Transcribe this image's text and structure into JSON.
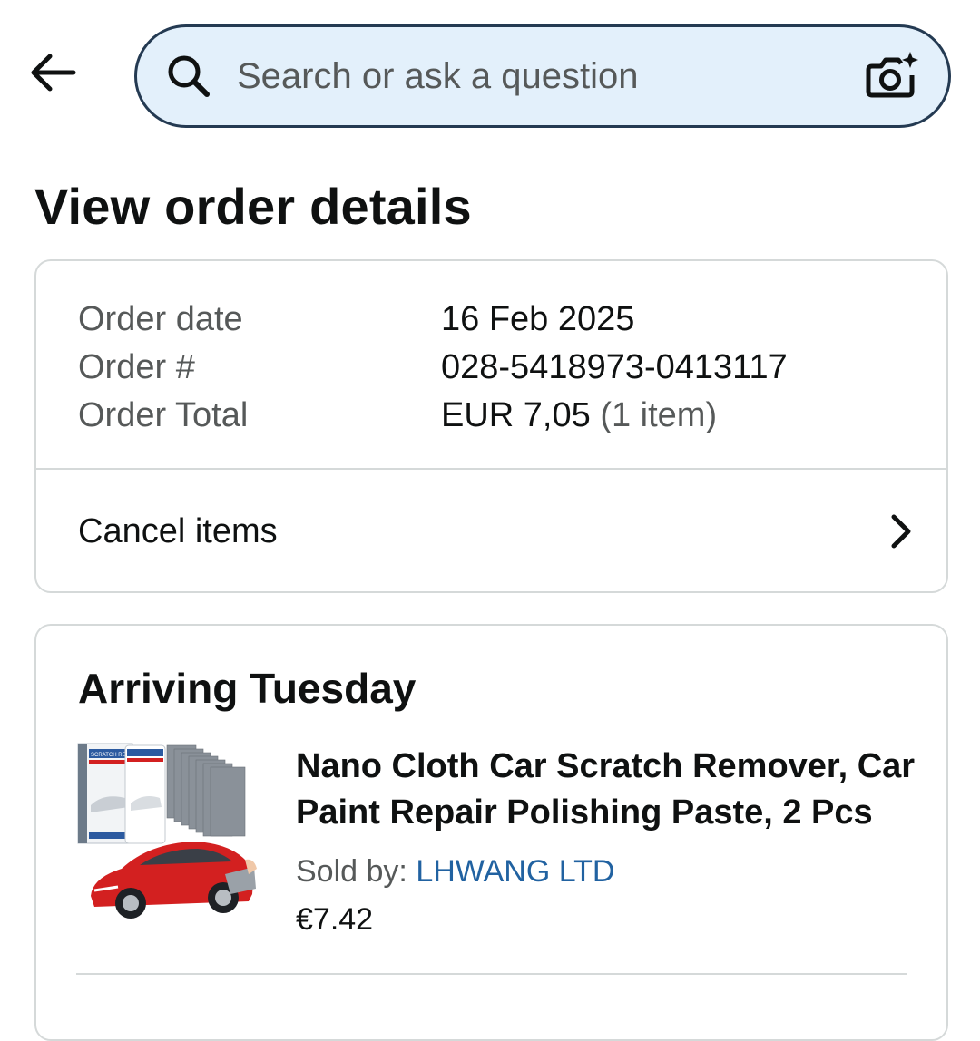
{
  "header": {
    "search_placeholder": "Search or ask a question"
  },
  "page": {
    "title": "View order details"
  },
  "summary": {
    "rows": [
      {
        "label": "Order date",
        "value": "16 Feb 2025"
      },
      {
        "label": "Order #",
        "value": "028-5418973-0413117"
      },
      {
        "label": "Order Total",
        "value": "EUR 7,05",
        "extra": "(1 item)"
      }
    ],
    "cancel_label": "Cancel items"
  },
  "shipment": {
    "title": "Arriving Tuesday",
    "product": {
      "name": "Nano Cloth Car Scratch Remover, Car Paint Repair Polishing Paste, 2 Pcs",
      "sold_by_label": "Sold by:",
      "seller": "LHWANG LTD",
      "price": "€7.42",
      "image_text": "SCRATCH REMOVER"
    }
  },
  "icons": {
    "back": "arrow-left-icon",
    "search": "search-icon",
    "camera": "camera-icon",
    "chevron": "chevron-right-icon"
  },
  "colors": {
    "search_bg": "#e3f0fb",
    "search_border": "#243a52",
    "link": "#2162a1",
    "muted_text": "#565959",
    "border": "#d5d9d9",
    "car_red": "#d32020"
  }
}
